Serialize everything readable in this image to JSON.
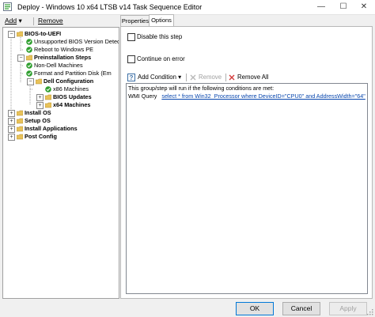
{
  "window": {
    "title": "Deploy - Windows 10 x64 LTSB v14 Task Sequence Editor",
    "minimize_glyph": "—",
    "maximize_glyph": "☐",
    "close_glyph": "✕",
    "app_icon": "task-sequence-icon"
  },
  "toolbar": {
    "add_label": "Add",
    "add_arrow": "▾",
    "remove_label": "Remove"
  },
  "tree": {
    "items": [
      {
        "label": "BIOS-to-UEFI",
        "icon": "folder-icon",
        "bold": true,
        "expander": "−"
      },
      {
        "label": "Unsupported BIOS Version Detec",
        "icon": "check-icon",
        "bold": false
      },
      {
        "label": "Reboot to Windows PE",
        "icon": "check-icon",
        "bold": false
      },
      {
        "label": "Preinstallation Steps",
        "icon": "folder-icon",
        "bold": true,
        "expander": "−"
      },
      {
        "label": "Non-Dell Machines",
        "icon": "check-icon",
        "bold": false
      },
      {
        "label": "Format and Partition Disk (Em",
        "icon": "check-icon",
        "bold": false
      },
      {
        "label": "Dell Configuration",
        "icon": "folder-icon",
        "bold": true,
        "expander": "−"
      },
      {
        "label": "x86 Machines",
        "icon": "check-icon",
        "bold": false
      },
      {
        "label": "BIOS Updates",
        "icon": "folder-icon",
        "bold": true,
        "expander": "+"
      },
      {
        "label": "x64 Machines",
        "icon": "folder-icon",
        "bold": true,
        "expander": "+"
      },
      {
        "label": "Install OS",
        "icon": "folder-icon",
        "bold": true,
        "expander": "+"
      },
      {
        "label": "Setup OS",
        "icon": "folder-icon",
        "bold": true,
        "expander": "+"
      },
      {
        "label": "Install Applications",
        "icon": "folder-icon",
        "bold": true,
        "expander": "+"
      },
      {
        "label": "Post Config",
        "icon": "folder-icon",
        "bold": true,
        "expander": "+"
      }
    ]
  },
  "tabs": [
    {
      "label": "Properties",
      "active": false
    },
    {
      "label": "Options",
      "active": true
    }
  ],
  "options": {
    "disable_step": {
      "label": "Disable this step",
      "checked": false
    },
    "continue_on_error": {
      "label": "Continue on error",
      "checked": false
    },
    "condition_toolbar": {
      "add_condition": "Add Condition",
      "add_condition_arrow": "▾",
      "remove": "Remove",
      "remove_all": "Remove All"
    },
    "conditions": {
      "header": "This group/step will run if the following conditions are met:",
      "wmi_label": "WMI Query",
      "wmi_query": "select * from Win32_Processor where DeviceID=\"CPU0\" and AddressWidth=\"64\""
    }
  },
  "buttons": {
    "ok": "OK",
    "cancel": "Cancel",
    "apply": "Apply"
  },
  "colors": {
    "check_green": "#2e9e2e",
    "folder_yellow": "#e8c25a",
    "remove_red": "#d33b3b",
    "link_blue": "#0645ad",
    "accent_blue": "#0078d7"
  }
}
